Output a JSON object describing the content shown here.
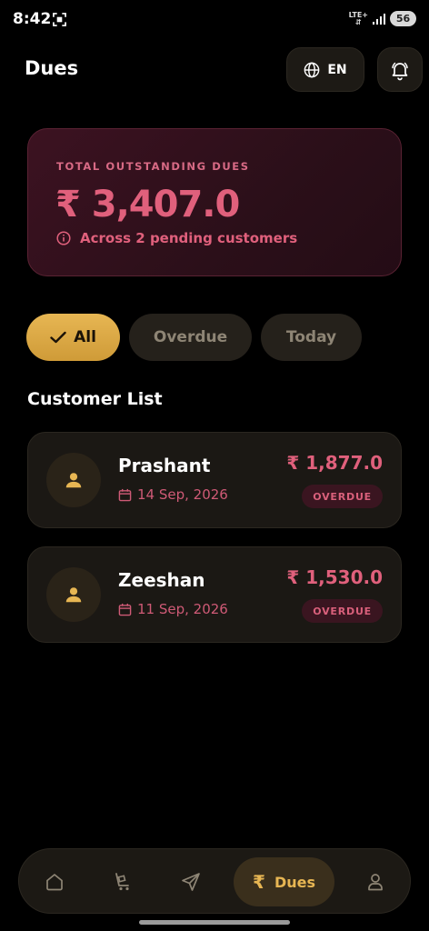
{
  "status_bar": {
    "time": "8:42",
    "network": "LTE+",
    "battery": "56"
  },
  "header": {
    "title": "Dues",
    "language": "EN"
  },
  "summary": {
    "label": "TOTAL OUTSTANDING DUES",
    "amount": "₹ 3,407.0",
    "subtitle": "Across 2 pending customers"
  },
  "filters": [
    {
      "label": "All",
      "selected": true
    },
    {
      "label": "Overdue",
      "selected": false
    },
    {
      "label": "Today",
      "selected": false
    }
  ],
  "section_title": "Customer List",
  "customers": [
    {
      "name": "Prashant",
      "date": "14 Sep, 2026",
      "amount": "₹ 1,877.0",
      "status": "OVERDUE"
    },
    {
      "name": "Zeeshan",
      "date": "11 Sep, 2026",
      "amount": "₹ 1,530.0",
      "status": "OVERDUE"
    }
  ],
  "bottom_nav": {
    "items": [
      "home-icon",
      "cart-icon",
      "send-icon",
      "rupee-icon",
      "profile-icon"
    ],
    "active_label": "Dues",
    "active_symbol": "₹"
  },
  "colors": {
    "accent_gold": "#e7b653",
    "overdue_pink": "#e0607c",
    "background": "#000000"
  }
}
